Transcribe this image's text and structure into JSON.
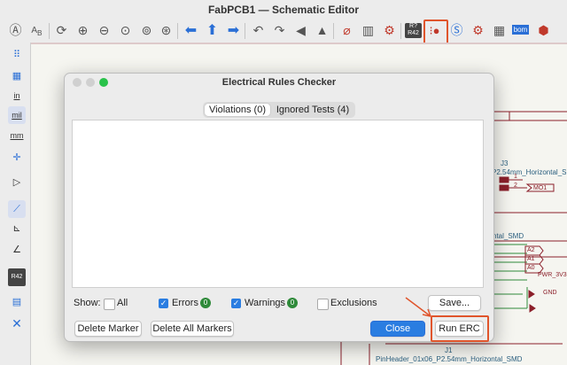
{
  "window": {
    "title": "FabPCB1 — Schematic Editor"
  },
  "toolbar": {
    "icons": [
      "highlight-net-icon",
      "annotate-icon",
      "refresh-icon",
      "zoom-in-icon",
      "zoom-out-icon",
      "zoom-fit-icon",
      "zoom-objects-icon",
      "zoom-selection-icon",
      "arrow-left-icon",
      "arrow-up-icon",
      "arrow-right-icon",
      "rotate-ccw-icon",
      "rotate-cw-icon",
      "mirror-horizontal-icon",
      "mirror-vertical-icon",
      "symbol-editor-icon",
      "symbol-library-icon",
      "symbol-browser-icon",
      "annotate-schematic-icon",
      "erc-icon",
      "simulator-icon",
      "assign-footprints-icon",
      "footprint-editor-icon",
      "bom-icon",
      "pcb-editor-icon"
    ],
    "annotate_label": "R?\nR42",
    "bom_label": "bom"
  },
  "left_toolbar": {
    "items": [
      {
        "name": "grid-dots-icon",
        "label": "⠿"
      },
      {
        "name": "grid-icon",
        "label": "▦"
      },
      {
        "name": "inch-units",
        "label": "in"
      },
      {
        "name": "mil-units",
        "label": "mil"
      },
      {
        "name": "mm-units",
        "label": "mm"
      },
      {
        "name": "cursor-crosshair-icon",
        "label": "✛"
      },
      {
        "name": "pin-icon",
        "label": "▷"
      },
      {
        "name": "bus-line-icon",
        "label": "⟋"
      },
      {
        "name": "wire-90-icon",
        "label": "⊾"
      },
      {
        "name": "wire-45-icon",
        "label": "∠"
      },
      {
        "name": "annotate-tool-icon",
        "label": "R42"
      },
      {
        "name": "hierarchy-navigator-icon",
        "label": "▤"
      },
      {
        "name": "tools-icon",
        "label": "✕"
      }
    ]
  },
  "canvas": {
    "labels": [
      "J3",
      "P2.54mm_Horizontal_S",
      "1",
      "2",
      "MO1",
      "ntal_SMD",
      "A2",
      "A1",
      "A0",
      "PWR_3V3",
      "GND",
      "J1",
      "PinHeader_01x06_P2.54mm_Horizontal_SMD"
    ]
  },
  "erc_dialog": {
    "title": "Electrical Rules Checker",
    "tabs": [
      {
        "label": "Violations (0)",
        "active": true
      },
      {
        "label": "Ignored Tests (4)",
        "active": false
      }
    ],
    "show_label": "Show:",
    "filters": [
      {
        "label": "All",
        "checked": false
      },
      {
        "label": "Errors",
        "checked": true,
        "count": "0"
      },
      {
        "label": "Warnings",
        "checked": true,
        "count": "0"
      },
      {
        "label": "Exclusions",
        "checked": false
      }
    ],
    "buttons": {
      "save": "Save...",
      "delete_marker": "Delete Marker",
      "delete_all_markers": "Delete All Markers",
      "close": "Close",
      "run_erc": "Run ERC"
    }
  },
  "colors": {
    "accent": "#2a7de1",
    "annotation": "#e0552c",
    "badge": "#2f8a3a",
    "schematic_line": "#8b1f2a",
    "net_label": "#8b1f2a",
    "power_green": "#2f8a3a"
  }
}
